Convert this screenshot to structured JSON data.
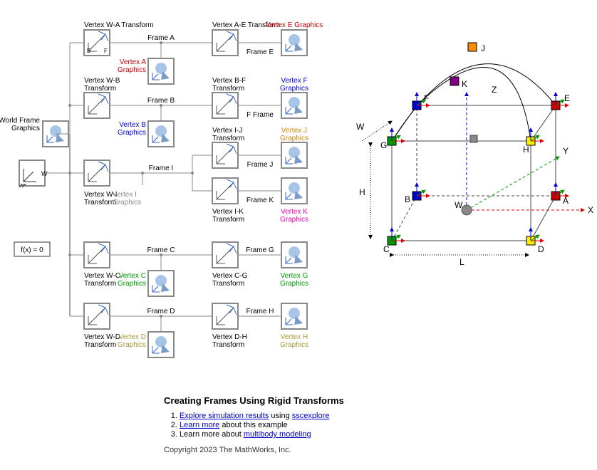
{
  "fx": "f(x) = 0",
  "wf": {
    "label": "World Frame\nGraphics",
    "port": "W"
  },
  "blocks": {
    "wa": "Vertex W-A Transform",
    "ae": "Vertex A-E Transform",
    "eg": "Vertex E Graphics",
    "ag": "Vertex A\nGraphics",
    "wb": "Vertex W-B\nTransform",
    "bf": "Vertex B-F\nTransform",
    "fg": "Vertex F\nGraphics",
    "bg": "Vertex B\nGraphics",
    "wi": "Vertex W-I\nTransform",
    "ij": "Vertex I-J\nTransform",
    "jg": "Vertex J\nGraphics",
    "ig": "Vertex I\nGraphics",
    "ik": "Vertex I-K\nTransform",
    "kg": "Vertex K\nGraphics",
    "wc": "Vertex W-C\nTransform",
    "cg2": "Vertex C-G\nTransform",
    "gg": "Vertex G\nGraphics",
    "cg": "Vertex C\nGraphics",
    "wd": "Vertex W-D\nTransform",
    "dh": "Vertex D-H\nTransform",
    "hg": "Vertex H\nGraphics",
    "dg": "Vertex D\nGraphics"
  },
  "frames": {
    "A": "Frame A",
    "B": "Frame B",
    "C": "Frame C",
    "D": "Frame D",
    "E": "Frame E",
    "F": "F Frame",
    "G": "Frame G",
    "H": "Frame H",
    "I": "Frame I",
    "J": "Frame J",
    "K": "Frame K"
  },
  "ports": {
    "B": "B",
    "F": "F",
    "R": "R"
  },
  "colors": {
    "eg": "#cc0000",
    "ag": "#cc0000",
    "fg": "#0000cc",
    "bg": "#0000cc",
    "jg": "#cc8800",
    "ig": "#888888",
    "kg": "#ee00aa",
    "gg": "#009900",
    "cg": "#009900",
    "hg": "#aa9933",
    "dg": "#aa9933"
  },
  "viz": {
    "axes": {
      "X": "X",
      "Y": "Y",
      "Z": "Z",
      "W": "W",
      "H": "H",
      "L": "L"
    },
    "verts": [
      "A",
      "B",
      "C",
      "D",
      "E",
      "F",
      "G",
      "H",
      "J",
      "K",
      "W"
    ]
  },
  "footer": {
    "title": "Creating Frames Using Rigid Transforms",
    "items": [
      {
        "pre": "",
        "link": "Explore simulation results",
        "mid": " using ",
        "link2": "sscexplore",
        "post": ""
      },
      {
        "pre": "",
        "link": "Learn more",
        "mid": " about this example",
        "link2": "",
        "post": ""
      },
      {
        "pre": "Learn more about ",
        "link": "multibody modeling",
        "mid": "",
        "link2": "",
        "post": ""
      }
    ],
    "copy": "Copyright 2023 The MathWorks, Inc."
  }
}
